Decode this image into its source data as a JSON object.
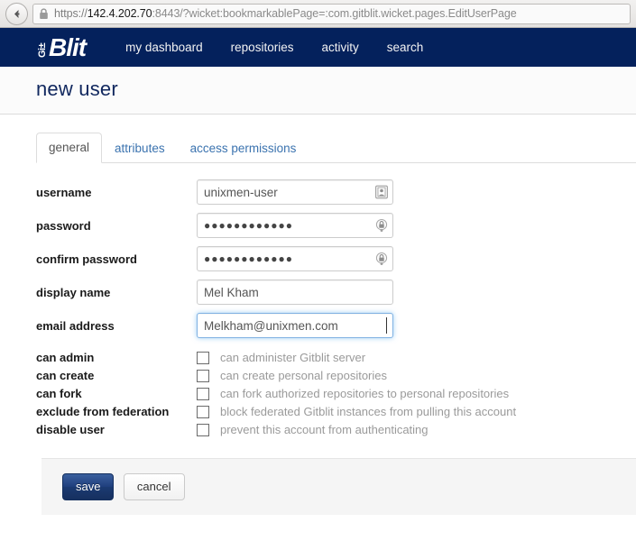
{
  "browser": {
    "back_icon": "back-arrow-icon",
    "lock_icon": "padlock-icon",
    "url_scheme": "https://",
    "url_host": "142.4.202.70",
    "url_rest": ":8443/?wicket:bookmarkablePage=:com.gitblit.wicket.pages.EditUserPage",
    "url_full": "https://142.4.202.70:8443/?wicket:bookmarkablePage=:com.gitblit.wicket.pages.EditUserPage"
  },
  "navbar": {
    "brand_prefix": "Gi±",
    "brand_name": "Blit",
    "links": [
      {
        "label": "my dashboard"
      },
      {
        "label": "repositories"
      },
      {
        "label": "activity"
      },
      {
        "label": "search"
      }
    ],
    "background_color": "#04215c"
  },
  "header": {
    "title": "new user"
  },
  "tabs": [
    {
      "label": "general",
      "active": true
    },
    {
      "label": "attributes",
      "active": false
    },
    {
      "label": "access permissions",
      "active": false
    }
  ],
  "form": {
    "fields": [
      {
        "label": "username",
        "value": "unixmen-user",
        "type": "text",
        "icon": "contact-card-icon",
        "focused": false
      },
      {
        "label": "password",
        "value": "●●●●●●●●●●●●",
        "type": "password",
        "icon": "key-icon",
        "focused": false
      },
      {
        "label": "confirm password",
        "value": "●●●●●●●●●●●●",
        "type": "password",
        "icon": "key-icon",
        "focused": false
      },
      {
        "label": "display name",
        "value": "Mel Kham",
        "type": "text",
        "icon": "",
        "focused": false
      },
      {
        "label": "email address",
        "value": "Melkham@unixmen.com",
        "type": "text",
        "icon": "",
        "focused": true
      }
    ],
    "checkboxes": [
      {
        "label": "can admin",
        "help": "can administer Gitblit server",
        "checked": false
      },
      {
        "label": "can create",
        "help": "can create personal repositories",
        "checked": false
      },
      {
        "label": "can fork",
        "help": "can fork authorized repositories to personal repositories",
        "checked": false
      },
      {
        "label": "exclude from federation",
        "help": "block federated Gitblit instances from pulling this account",
        "checked": false
      },
      {
        "label": "disable user",
        "help": "prevent this account from authenticating",
        "checked": false
      }
    ],
    "save_label": "save",
    "cancel_label": "cancel"
  }
}
